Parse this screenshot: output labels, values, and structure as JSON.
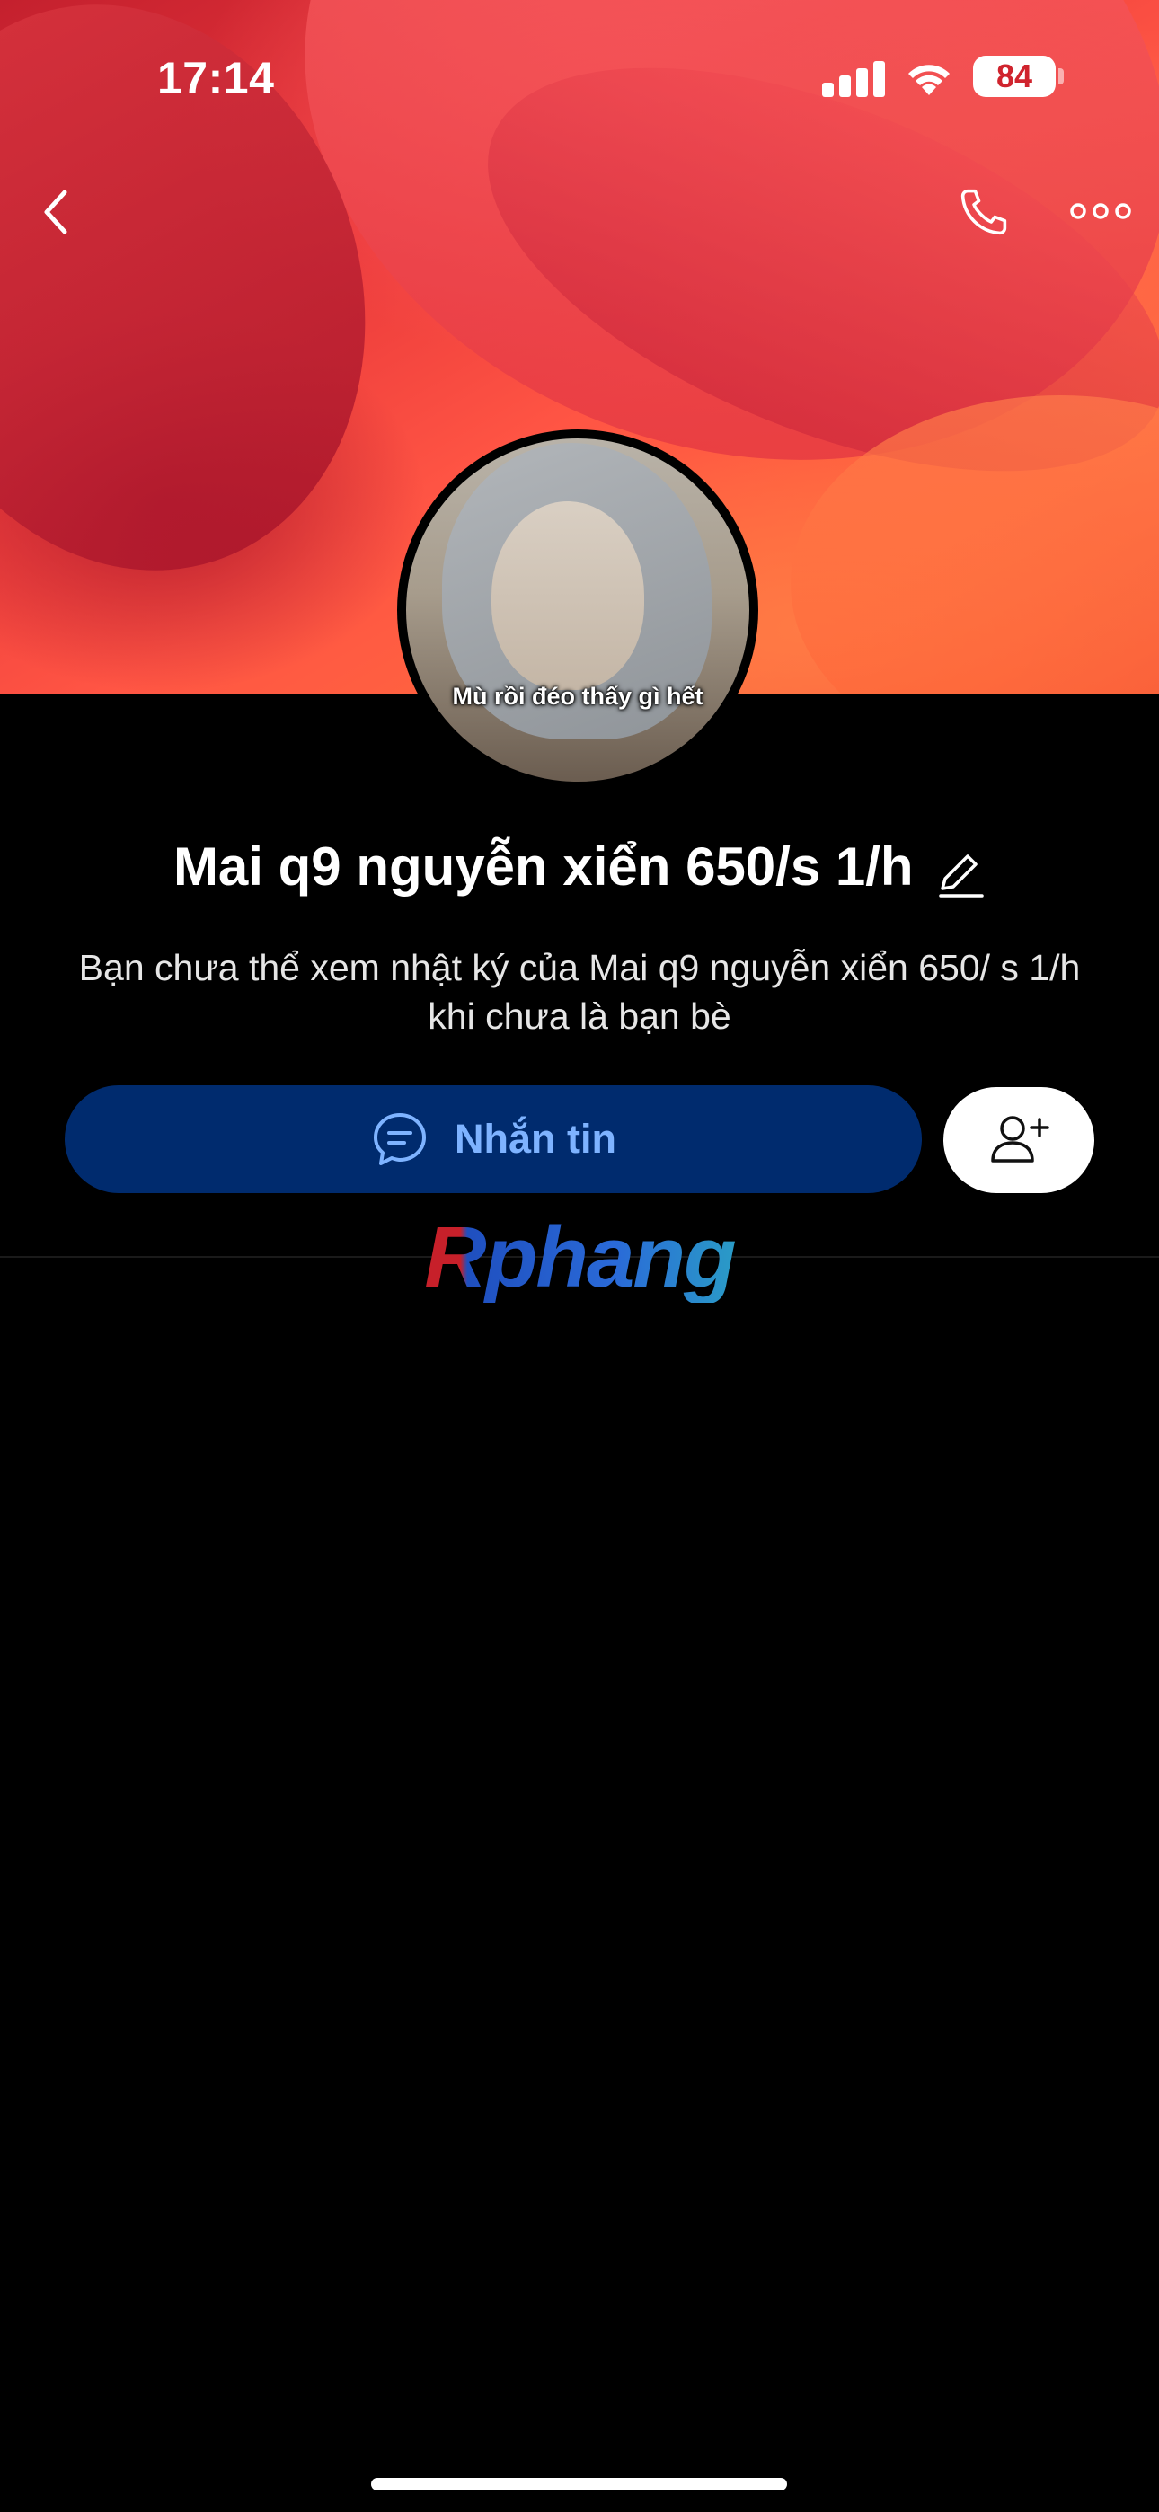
{
  "status_bar": {
    "time": "17:14",
    "battery": "84",
    "signal_bars": 4,
    "battery_color": "#d0242e"
  },
  "nav": {
    "back_icon": "chevron-left-icon",
    "call_icon": "phone-icon",
    "more_icon": "more-horizontal-icon"
  },
  "profile": {
    "avatar_caption": "Mù rồi đéo thấy gì hết",
    "name": "Mai q9 nguyễn xiển 650/s 1/h",
    "info": "Bạn chưa thể xem nhật ký của Mai q9 nguyễn xiển 650/ s 1/h khi chưa là bạn bè"
  },
  "actions": {
    "message_label": "Nhắn tin",
    "message_icon": "chat-bubble-icon",
    "add_friend_icon": "add-user-icon",
    "message_bg": "#002b6e",
    "message_text_color": "#7eb3ff"
  },
  "watermark": {
    "text": "Rphang"
  }
}
